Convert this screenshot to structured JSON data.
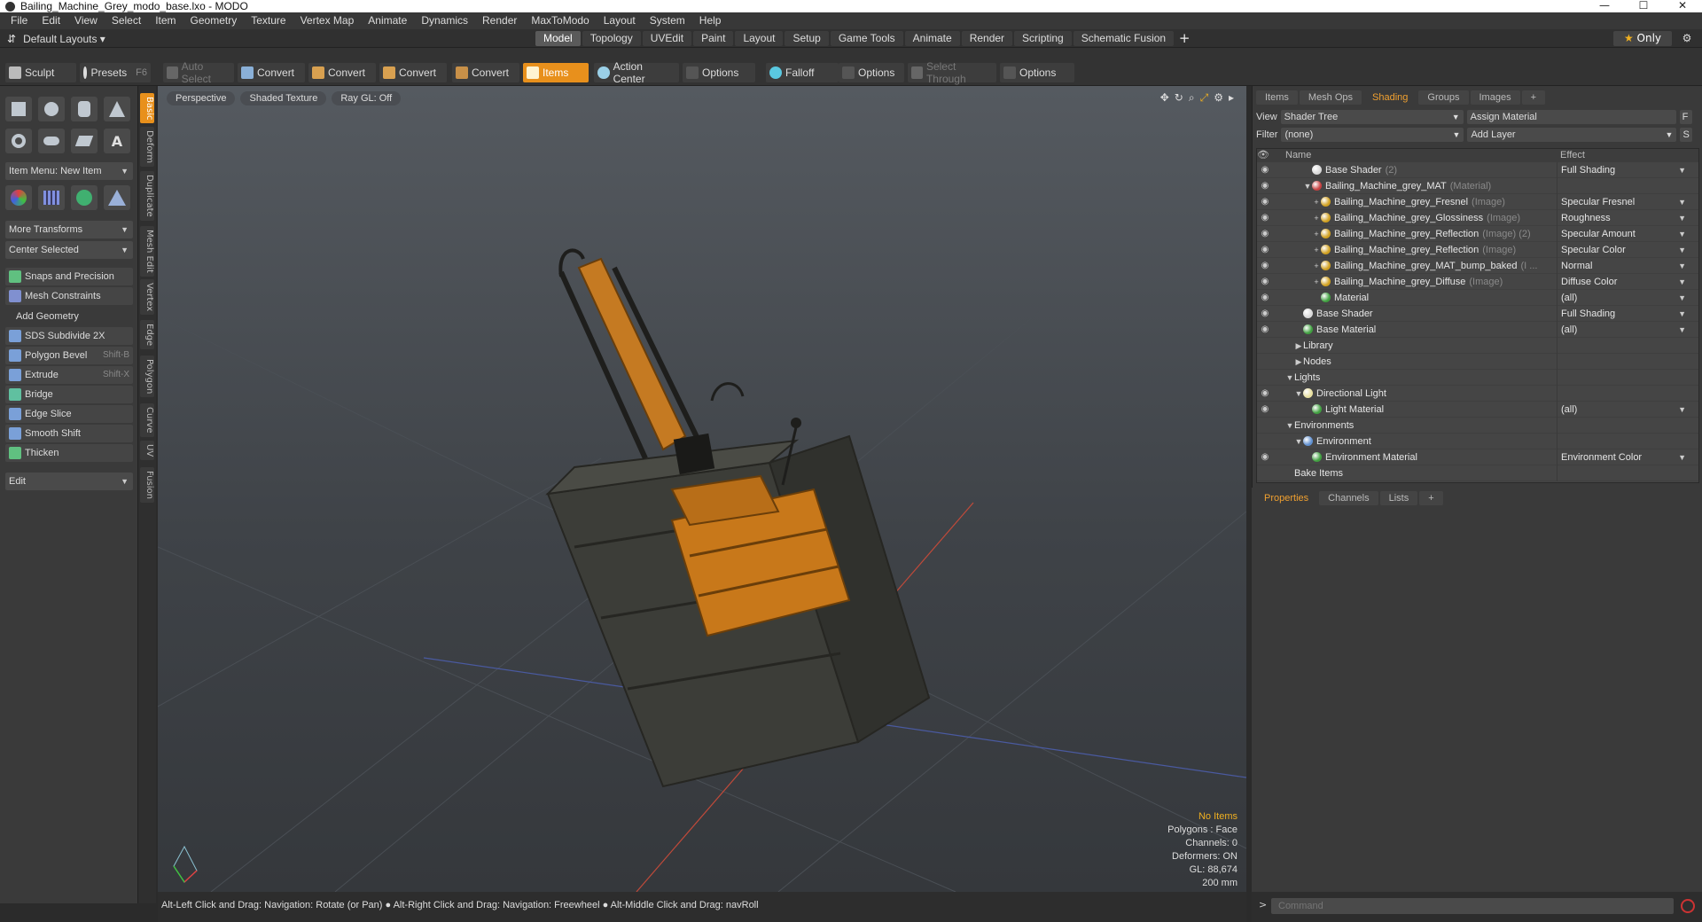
{
  "window": {
    "title": "Bailing_Machine_Grey_modo_base.lxo - MODO",
    "minimize": "—",
    "maximize": "☐",
    "close": "✕"
  },
  "menu": [
    "File",
    "Edit",
    "View",
    "Select",
    "Item",
    "Geometry",
    "Texture",
    "Vertex Map",
    "Animate",
    "Dynamics",
    "Render",
    "MaxToModo",
    "Layout",
    "System",
    "Help"
  ],
  "layout": {
    "selector": "Default Layouts ▾",
    "tabs": [
      "Model",
      "Topology",
      "UVEdit",
      "Paint",
      "Layout",
      "Setup",
      "Game Tools",
      "Animate",
      "Render",
      "Scripting",
      "Schematic Fusion"
    ],
    "active_tab": "Model",
    "only": "Only"
  },
  "toolbar": {
    "sculpt": "Sculpt",
    "presets": "Presets",
    "presets_key": "F6",
    "auto_select": "Auto Select",
    "convert1": "Convert",
    "convert2": "Convert",
    "convert3": "Convert",
    "convert4": "Convert",
    "items": "Items",
    "action_center": "Action Center",
    "options1": "Options",
    "falloff": "Falloff",
    "options2": "Options",
    "select_through": "Select Through",
    "options3": "Options"
  },
  "left": {
    "item_menu": "Item Menu: New Item",
    "more_transforms": "More Transforms",
    "center_selected": "Center Selected",
    "snaps": "Snaps and Precision",
    "mesh_constraints": "Mesh Constraints",
    "add_geometry": "Add Geometry",
    "tools": [
      {
        "label": "SDS Subdivide 2X",
        "key": ""
      },
      {
        "label": "Polygon Bevel",
        "key": "Shift-B"
      },
      {
        "label": "Extrude",
        "key": "Shift-X"
      },
      {
        "label": "Bridge",
        "key": ""
      },
      {
        "label": "Edge Slice",
        "key": ""
      },
      {
        "label": "Smooth Shift",
        "key": ""
      },
      {
        "label": "Thicken",
        "key": ""
      }
    ],
    "edit": "Edit",
    "vtabs": [
      "Basic",
      "Deform",
      "Duplicate",
      "Mesh Edit",
      "Vertex",
      "Edge",
      "Polygon",
      "Curve",
      "UV",
      "Fusion"
    ]
  },
  "viewport": {
    "tabs": [
      "Perspective",
      "Shaded Texture",
      "Ray GL: Off"
    ],
    "info": {
      "items": "No Items",
      "polygons": "Polygons : Face",
      "channels": "Channels: 0",
      "deformers": "Deformers: ON",
      "gl": "GL: 88,674",
      "scale": "200 mm"
    }
  },
  "status": {
    "hint": "Alt-Left Click and Drag: Navigation: Rotate (or Pan) ● Alt-Right Click and Drag: Navigation: Freewheel ● Alt-Middle Click and Drag: navRoll"
  },
  "right": {
    "tabs": [
      "Items",
      "Mesh Ops",
      "Shading",
      "Groups",
      "Images"
    ],
    "active_tab": "Shading",
    "view_label": "View",
    "view_value": "Shader Tree",
    "assign_material": "Assign Material",
    "f_btn": "F",
    "filter_label": "Filter",
    "filter_value": "(none)",
    "add_layer": "Add Layer",
    "s_btn": "S",
    "col_name": "Name",
    "col_effect": "Effect",
    "rows": [
      {
        "indent": 3,
        "name": "Base Shader",
        "type": "(2)",
        "effect": "Full Shading",
        "ball": "#d8d8d8",
        "eye": true,
        "tw": ""
      },
      {
        "indent": 3,
        "name": "Bailing_Machine_grey_MAT",
        "type": "(Material)",
        "effect": "",
        "ball": "#c84040",
        "eye": true,
        "tw": "▼"
      },
      {
        "indent": 4,
        "name": "Bailing_Machine_grey_Fresnel",
        "type": "(Image)",
        "effect": "Specular Fresnel",
        "ball": "#d0a020",
        "eye": true,
        "tw": "+"
      },
      {
        "indent": 4,
        "name": "Bailing_Machine_grey_Glossiness",
        "type": "(Image)",
        "effect": "Roughness",
        "ball": "#d0a020",
        "eye": true,
        "tw": "+"
      },
      {
        "indent": 4,
        "name": "Bailing_Machine_grey_Reflection",
        "type": "(Image) (2)",
        "effect": "Specular Amount",
        "ball": "#d0a020",
        "eye": true,
        "tw": "+"
      },
      {
        "indent": 4,
        "name": "Bailing_Machine_grey_Reflection",
        "type": "(Image)",
        "effect": "Specular Color",
        "ball": "#d0a020",
        "eye": true,
        "tw": "+"
      },
      {
        "indent": 4,
        "name": "Bailing_Machine_grey_MAT_bump_baked",
        "type": "(I ...",
        "effect": "Normal",
        "ball": "#d0a020",
        "eye": true,
        "tw": "+"
      },
      {
        "indent": 4,
        "name": "Bailing_Machine_grey_Diffuse",
        "type": "(Image)",
        "effect": "Diffuse Color",
        "ball": "#d0a020",
        "eye": true,
        "tw": "+"
      },
      {
        "indent": 4,
        "name": "Material",
        "type": "",
        "effect": "(all)",
        "ball": "#40a040",
        "eye": true,
        "tw": ""
      },
      {
        "indent": 2,
        "name": "Base Shader",
        "type": "",
        "effect": "Full Shading",
        "ball": "#d8d8d8",
        "eye": true,
        "tw": ""
      },
      {
        "indent": 2,
        "name": "Base Material",
        "type": "",
        "effect": "(all)",
        "ball": "#40a040",
        "eye": true,
        "tw": ""
      },
      {
        "indent": 2,
        "name": "Library",
        "type": "",
        "effect": "",
        "ball": "",
        "eye": false,
        "tw": "▶"
      },
      {
        "indent": 2,
        "name": "Nodes",
        "type": "",
        "effect": "",
        "ball": "",
        "eye": false,
        "tw": "▶"
      },
      {
        "indent": 1,
        "name": "Lights",
        "type": "",
        "effect": "",
        "ball": "",
        "eye": false,
        "tw": "▼"
      },
      {
        "indent": 2,
        "name": "Directional Light",
        "type": "",
        "effect": "",
        "ball": "#e8e0a0",
        "eye": true,
        "tw": "▼"
      },
      {
        "indent": 3,
        "name": "Light Material",
        "type": "",
        "effect": "(all)",
        "ball": "#40a040",
        "eye": true,
        "tw": ""
      },
      {
        "indent": 1,
        "name": "Environments",
        "type": "",
        "effect": "",
        "ball": "",
        "eye": false,
        "tw": "▼"
      },
      {
        "indent": 2,
        "name": "Environment",
        "type": "",
        "effect": "",
        "ball": "#6090d0",
        "eye": false,
        "tw": "▼"
      },
      {
        "indent": 3,
        "name": "Environment Material",
        "type": "",
        "effect": "Environment Color",
        "ball": "#40a040",
        "eye": true,
        "tw": ""
      },
      {
        "indent": 1,
        "name": "Bake Items",
        "type": "",
        "effect": "",
        "ball": "",
        "eye": false,
        "tw": ""
      }
    ],
    "props_tabs": [
      "Properties",
      "Channels",
      "Lists"
    ],
    "command_placeholder": "Command"
  }
}
